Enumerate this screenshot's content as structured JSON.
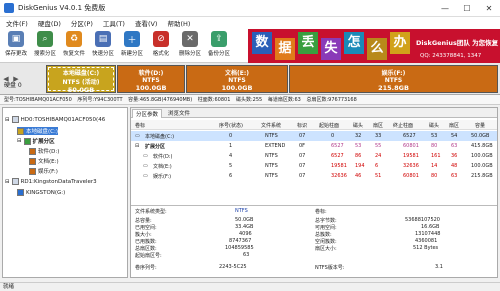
{
  "window": {
    "title": "DiskGenius V4.0.1 免费版",
    "controls": [
      "—",
      "☐",
      "✕"
    ]
  },
  "menu": [
    "文件(F)",
    "硬盘(D)",
    "分区(P)",
    "工具(T)",
    "查看(V)",
    "帮助(H)"
  ],
  "toolbar": [
    {
      "label": "保存更改",
      "icon": "save-icon",
      "color": "#5a7fb5"
    },
    {
      "label": "搜索分区",
      "icon": "search-icon",
      "color": "#3f8d4a"
    },
    {
      "label": "恢复文件",
      "icon": "recover-icon",
      "color": "#e08a1e"
    },
    {
      "label": "快速分区",
      "icon": "quick-partition-icon",
      "color": "#4a6fb5"
    },
    {
      "label": "新建分区",
      "icon": "new-partition-icon",
      "color": "#2f78c4"
    },
    {
      "label": "格式化",
      "icon": "format-icon",
      "color": "#c8302a"
    },
    {
      "label": "删除分区",
      "icon": "delete-partition-icon",
      "color": "#6a6a6a"
    },
    {
      "label": "备份分区",
      "icon": "backup-partition-icon",
      "color": "#3a9e6b"
    }
  ],
  "banner": {
    "tiles": [
      {
        "char": "数",
        "color": "#2a5fb8"
      },
      {
        "char": "据",
        "color": "#e07b1a"
      },
      {
        "char": "丢",
        "color": "#3a9e3f"
      },
      {
        "char": "失",
        "color": "#8a3ab8"
      },
      {
        "char": "怎",
        "color": "#1a8ab8"
      },
      {
        "char": "么",
        "color": "#b8891a"
      },
      {
        "char": "办",
        "color": "#d1a21a"
      }
    ],
    "slogan": "DiskGenius团队 为您恢复",
    "qq": "QQ: 243378841, 1347"
  },
  "disk": {
    "label": "硬盘 0",
    "partitions": [
      {
        "name": "本地磁盘(C:)",
        "fs": "NTFS (活动)",
        "size": "50.0GB",
        "color": "#c8a41e",
        "selected": true
      },
      {
        "name": "软件(D:)",
        "fs": "NTFS",
        "size": "100.0GB",
        "color": "#c96a14",
        "selected": false
      },
      {
        "name": "文档(E:)",
        "fs": "NTFS",
        "size": "100.0GB",
        "color": "#c96a14",
        "selected": false
      },
      {
        "name": "娱乐(F:)",
        "fs": "NTFS",
        "size": "215.8GB",
        "color": "#c96a14",
        "selected": false
      }
    ]
  },
  "info_line": [
    "型号:TOSHIBAMQ01ACF050",
    "序列号:Y94C300TT",
    "容量:465.8GB(476940MB)",
    "柱面数:60801",
    "磁头数:255",
    "每道扇区数:63",
    "总扇区数:976773168"
  ],
  "tree": [
    {
      "label": "HD0:TOSHIBAMQ01ACF050(46",
      "level": 0,
      "selected": false
    },
    {
      "label": "本地磁盘(C:)",
      "level": 1,
      "selected": true
    },
    {
      "label": "扩展分区",
      "level": 1,
      "selected": false
    },
    {
      "label": "软件(D:)",
      "level": 2,
      "selected": false
    },
    {
      "label": "文档(E:)",
      "level": 2,
      "selected": false
    },
    {
      "label": "娱乐(F:)",
      "level": 2,
      "selected": false
    },
    {
      "label": "RD1:KingstonDataTraveler3",
      "level": 0,
      "selected": false
    },
    {
      "label": "KINGSTON(G:)",
      "level": 1,
      "selected": false
    }
  ],
  "tabs": [
    "分区参数",
    "浏览文件"
  ],
  "table": {
    "headers": [
      "卷标",
      "序号(状态)",
      "文件系统",
      "标识",
      "起始柱面",
      "磁头",
      "扇区",
      "终止柱面",
      "磁头",
      "扇区",
      "容量"
    ],
    "rows": [
      {
        "cells": [
          "本地磁盘(C:)",
          "0",
          "NTFS",
          "07",
          "0",
          "32",
          "33",
          "6527",
          "53",
          "54",
          "50.0GB"
        ],
        "style": "sel"
      },
      {
        "cells": [
          "扩展分区",
          "1",
          "EXTEND",
          "0F",
          "6527",
          "53",
          "55",
          "60801",
          "80",
          "63",
          "415.8GB"
        ],
        "style": "pink"
      },
      {
        "cells": [
          "软件(D:)",
          "4",
          "NTFS",
          "07",
          "6527",
          "86",
          "24",
          "19581",
          "161",
          "36",
          "100.0GB"
        ],
        "style": "red"
      },
      {
        "cells": [
          "文档(E:)",
          "5",
          "NTFS",
          "07",
          "19581",
          "194",
          "6",
          "32636",
          "14",
          "48",
          "100.0GB"
        ],
        "style": "red"
      },
      {
        "cells": [
          "娱乐(F:)",
          "6",
          "NTFS",
          "07",
          "32636",
          "46",
          "51",
          "60801",
          "80",
          "63",
          "215.8GB"
        ],
        "style": "red"
      }
    ]
  },
  "details": {
    "fs_type_label": "文件系统类型:",
    "fs_type_value": "NTFS",
    "vol_label": "卷标:",
    "vol_value": "",
    "left": [
      {
        "k": "总容量:",
        "v": "50.0GB"
      },
      {
        "k": "已用空间:",
        "v": "33.4GB"
      },
      {
        "k": "簇大小:",
        "v": "4096"
      },
      {
        "k": "已用簇数:",
        "v": "8747367"
      },
      {
        "k": "总扇区数:",
        "v": "104859585"
      },
      {
        "k": "起始扇区号:",
        "v": "63"
      }
    ],
    "right": [
      {
        "k": "总字节数:",
        "v": "53688107520"
      },
      {
        "k": "可用空间:",
        "v": "16.6GB"
      },
      {
        "k": "总簇数:",
        "v": "13107448"
      },
      {
        "k": "空闲簇数:",
        "v": "4360081"
      },
      {
        "k": "扇区大小:",
        "v": "512 Bytes"
      },
      {
        "k": "",
        "v": ""
      }
    ],
    "serial_label": "卷序列号:",
    "serial_value": "2243-5C25",
    "ntfs_ver_label": "NTFS版本号:",
    "ntfs_ver_value": "3.1"
  },
  "status": "就绪"
}
